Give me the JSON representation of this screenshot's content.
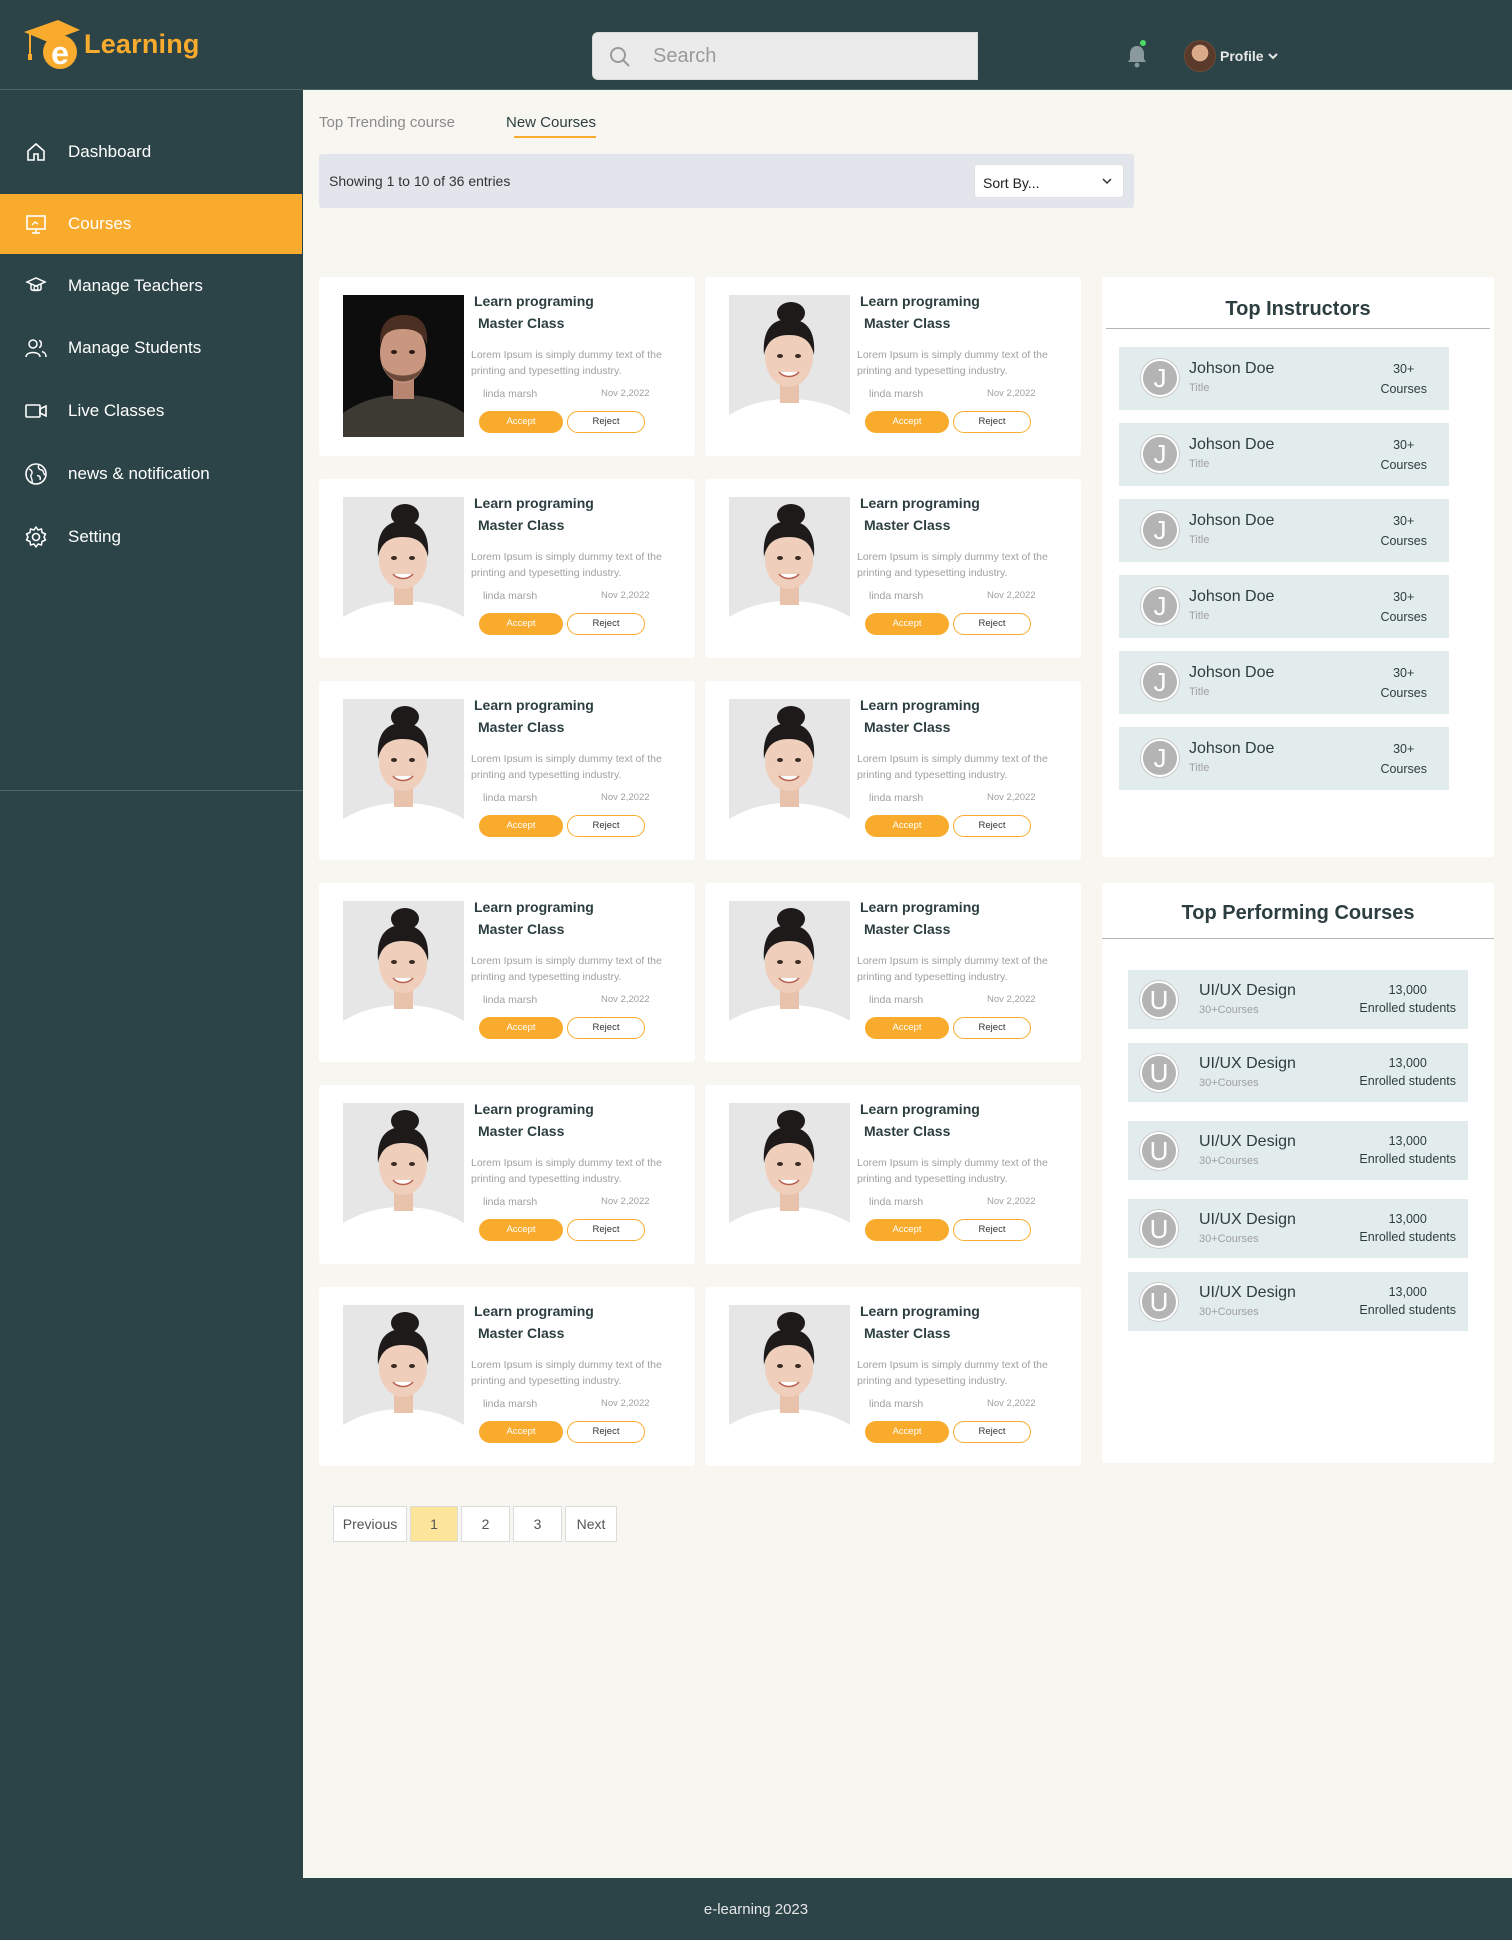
{
  "app": {
    "logo_text": "Learning",
    "logo_letter": "e"
  },
  "search": {
    "placeholder": "Search"
  },
  "profile": {
    "label": "Profile"
  },
  "sidebar": {
    "items": [
      {
        "label": "Dashboard",
        "icon": "home-icon"
      },
      {
        "label": "Courses",
        "icon": "presentation-icon",
        "active": true
      },
      {
        "label": "Manage Teachers",
        "icon": "teacher-icon"
      },
      {
        "label": "Manage Students",
        "icon": "users-icon"
      },
      {
        "label": "Live Classes",
        "icon": "video-icon"
      },
      {
        "label": "news & notification",
        "icon": "globe-icon"
      },
      {
        "label": "Setting",
        "icon": "gear-icon"
      }
    ]
  },
  "tabs": {
    "top": "Top  Trending course",
    "new": "New Courses"
  },
  "listing": {
    "entries_text": "Showing 1 to 10 of 36 entries",
    "sort_label": "Sort By..."
  },
  "card_template": {
    "title_line1": "Learn programing",
    "title_line2": "Master Class",
    "description": "Lorem Ipsum is simply dummy text of the printing and typesetting industry.",
    "author": "linda marsh",
    "date": "Nov 2,2022",
    "accept_label": "Accept",
    "reject_label": "Reject"
  },
  "cards": [
    {
      "photo": "man"
    },
    {
      "photo": "woman"
    },
    {
      "photo": "woman"
    },
    {
      "photo": "woman"
    },
    {
      "photo": "woman"
    },
    {
      "photo": "woman"
    },
    {
      "photo": "woman"
    },
    {
      "photo": "woman"
    },
    {
      "photo": "woman"
    },
    {
      "photo": "woman"
    },
    {
      "photo": "woman"
    },
    {
      "photo": "woman"
    }
  ],
  "top_instructors": {
    "title": "Top Instructors",
    "items": [
      {
        "initial": "J",
        "name": "Johson Doe",
        "sub": "Title",
        "count": "30+",
        "count_label": "Courses"
      },
      {
        "initial": "J",
        "name": "Johson Doe",
        "sub": "Title",
        "count": "30+",
        "count_label": "Courses"
      },
      {
        "initial": "J",
        "name": "Johson Doe",
        "sub": "Title",
        "count": "30+",
        "count_label": "Courses"
      },
      {
        "initial": "J",
        "name": "Johson Doe",
        "sub": "Title",
        "count": "30+",
        "count_label": "Courses"
      },
      {
        "initial": "J",
        "name": "Johson Doe",
        "sub": "Title",
        "count": "30+",
        "count_label": "Courses"
      },
      {
        "initial": "J",
        "name": "Johson Doe",
        "sub": "Title",
        "count": "30+",
        "count_label": "Courses"
      }
    ]
  },
  "top_courses": {
    "title": "Top Performing Courses",
    "items": [
      {
        "initial": "U",
        "name": "UI/UX Design",
        "sub": "30+Courses",
        "count": "13,000",
        "count_label": "Enrolled students"
      },
      {
        "initial": "U",
        "name": "UI/UX Design",
        "sub": "30+Courses",
        "count": "13,000",
        "count_label": "Enrolled students"
      },
      {
        "initial": "U",
        "name": "UI/UX Design",
        "sub": "30+Courses",
        "count": "13,000",
        "count_label": "Enrolled students"
      },
      {
        "initial": "U",
        "name": "UI/UX Design",
        "sub": "30+Courses",
        "count": "13,000",
        "count_label": "Enrolled students"
      },
      {
        "initial": "U",
        "name": "UI/UX Design",
        "sub": "30+Courses",
        "count": "13,000",
        "count_label": "Enrolled students"
      }
    ]
  },
  "pagination": {
    "previous": "Previous",
    "pages": [
      "1",
      "2",
      "3"
    ],
    "current": "1",
    "next": "Next"
  },
  "footer": {
    "text": "e-learning 2023"
  },
  "colors": {
    "brand": "#f9ab2d",
    "sidebar": "#2c4447",
    "background": "#f8f6f1",
    "panel_row": "#e3ecec"
  }
}
